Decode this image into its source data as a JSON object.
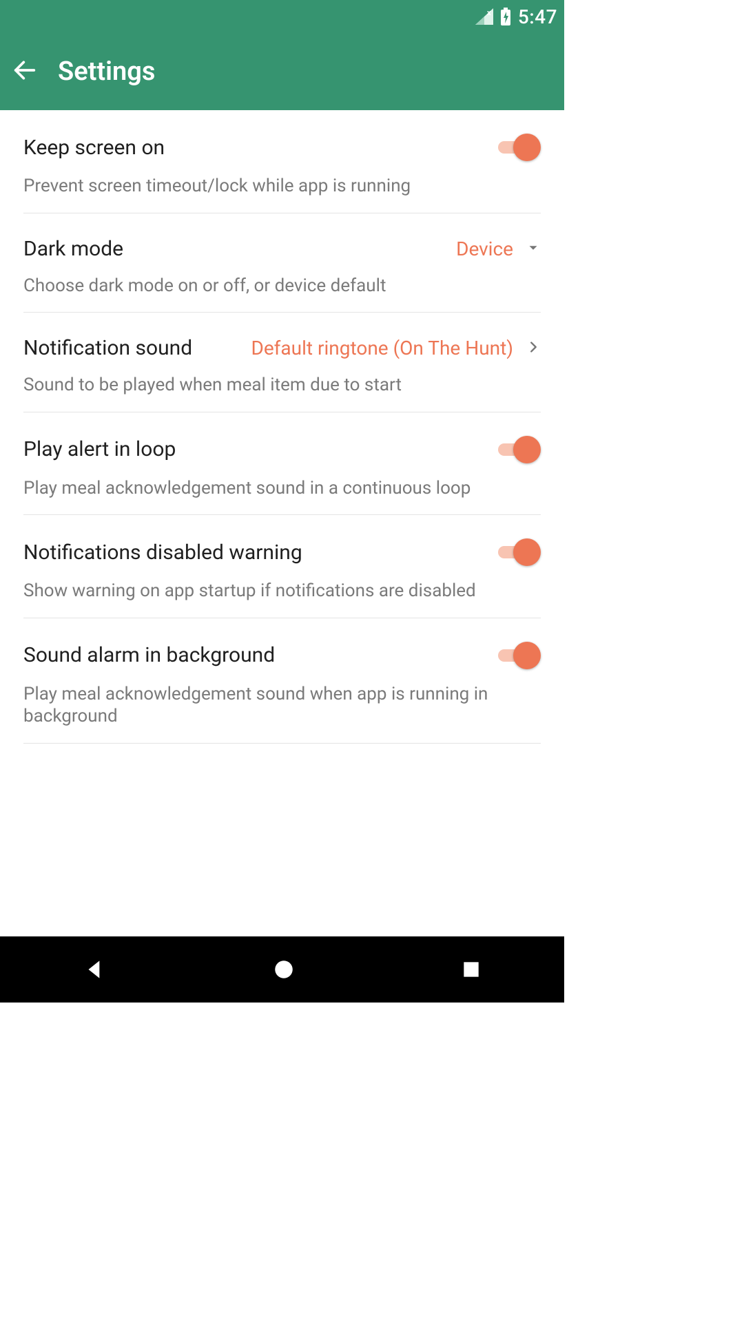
{
  "status": {
    "time": "5:47"
  },
  "header": {
    "title": "Settings"
  },
  "settings": {
    "keep_screen": {
      "title": "Keep screen on",
      "sub": "Prevent screen timeout/lock while app is running"
    },
    "dark_mode": {
      "title": "Dark mode",
      "value": "Device",
      "sub": "Choose dark mode on or off, or device default"
    },
    "notification_sound": {
      "title": "Notification sound",
      "value": "Default ringtone (On The Hunt)",
      "sub": "Sound to be played when meal item due to start"
    },
    "play_loop": {
      "title": "Play alert in loop",
      "sub": "Play meal acknowledgement sound in a continuous loop"
    },
    "notif_disabled_warn": {
      "title": "Notifications disabled warning",
      "sub": "Show warning on app startup if notifications are disabled"
    },
    "sound_bg": {
      "title": "Sound alarm in background",
      "sub": "Play meal acknowledgement sound when app is running in background"
    }
  }
}
